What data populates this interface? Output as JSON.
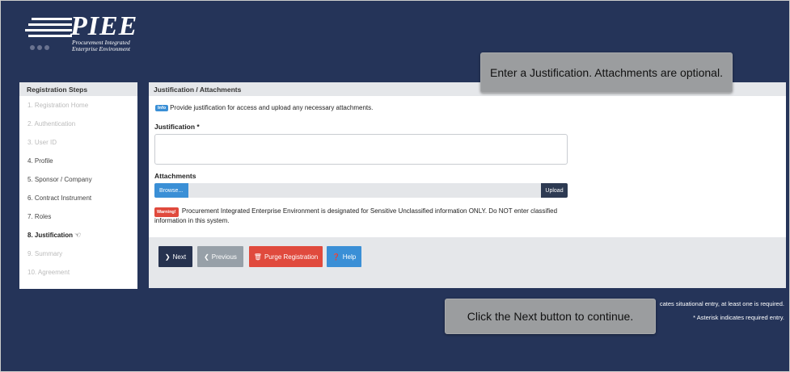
{
  "logo": {
    "title": "PIEE",
    "subtitle_line1": "Procurement Integrated",
    "subtitle_line2": "Enterprise Environment"
  },
  "sidebar": {
    "heading": "Registration Steps",
    "steps": [
      {
        "label": "1. Registration Home",
        "state": "disabled"
      },
      {
        "label": "2. Authentication",
        "state": "disabled"
      },
      {
        "label": "3. User ID",
        "state": "disabled"
      },
      {
        "label": "4. Profile",
        "state": "done"
      },
      {
        "label": "5. Sponsor / Company",
        "state": "done"
      },
      {
        "label": "6. Contract Instrument",
        "state": "done"
      },
      {
        "label": "7. Roles",
        "state": "done"
      },
      {
        "label": "8. Justification",
        "state": "active"
      },
      {
        "label": "9. Summary",
        "state": "disabled"
      },
      {
        "label": "10. Agreement",
        "state": "disabled"
      }
    ]
  },
  "panel": {
    "heading": "Justification / Attachments",
    "info_badge": "Info",
    "info_text": "Provide justification for access and upload any necessary attachments.",
    "justification_label": "Justification *",
    "justification_value": "",
    "attachments_label": "Attachments",
    "browse_label": "Browse...",
    "upload_label": "Upload",
    "warning_badge": "Warning!",
    "warning_text": "Procurement Integrated Enterprise Environment is designated for Sensitive Unclassified information ONLY. Do NOT enter classified information in this system."
  },
  "buttons": {
    "next": "Next",
    "previous": "Previous",
    "purge": "Purge Registration",
    "help": "Help"
  },
  "tooltips": {
    "top": "Enter a Justification. Attachments are optional.",
    "bottom": "Click the Next button to continue."
  },
  "notes": {
    "situational": "cates situational entry, at least one is required.",
    "asterisk": "* Asterisk indicates required entry."
  },
  "colors": {
    "background": "#253459",
    "primary_blue": "#3a8fd6",
    "danger_red": "#e04a3d",
    "dark_navy": "#26324f"
  }
}
